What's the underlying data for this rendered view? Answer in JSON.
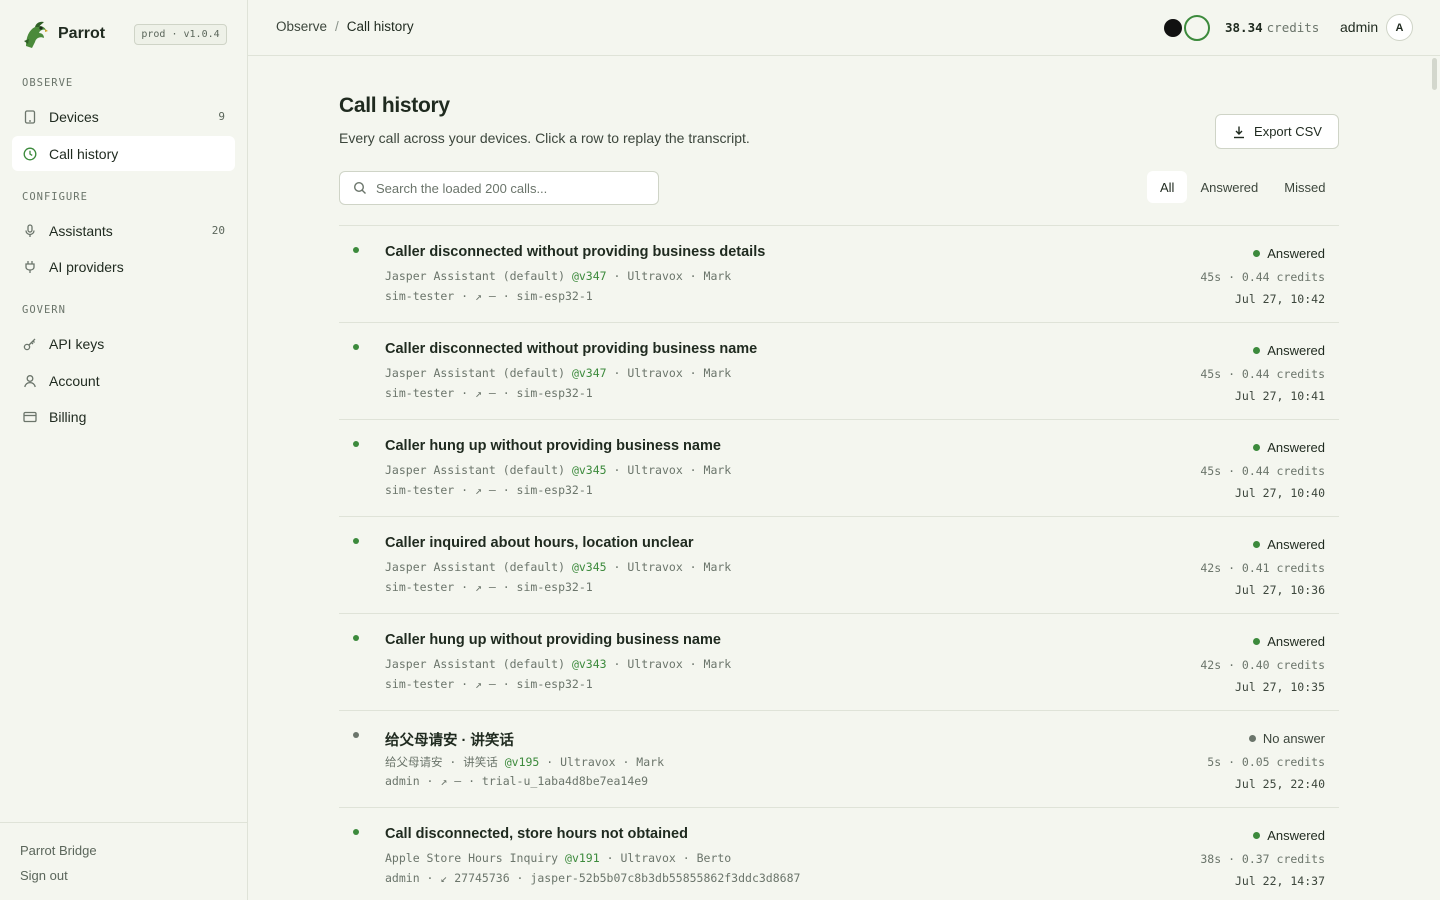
{
  "app": {
    "name": "Parrot",
    "env_badge": "prod · v1.0.4"
  },
  "sidebar": {
    "sections": [
      {
        "label": "OBSERVE",
        "items": [
          {
            "label": "Devices",
            "icon": "tablet-icon",
            "count": "9",
            "active": false
          },
          {
            "label": "Call history",
            "icon": "clock-icon",
            "count": "",
            "active": true
          }
        ]
      },
      {
        "label": "CONFIGURE",
        "items": [
          {
            "label": "Assistants",
            "icon": "microphone-icon",
            "count": "20",
            "active": false
          },
          {
            "label": "AI providers",
            "icon": "plug-icon",
            "count": "",
            "active": false
          }
        ]
      },
      {
        "label": "GOVERN",
        "items": [
          {
            "label": "API keys",
            "icon": "key-icon",
            "count": "",
            "active": false
          },
          {
            "label": "Account",
            "icon": "user-icon",
            "count": "",
            "active": false
          },
          {
            "label": "Billing",
            "icon": "credit-card-icon",
            "count": "",
            "active": false
          }
        ]
      }
    ],
    "footer": {
      "bridge_label": "Parrot Bridge",
      "signout_label": "Sign out"
    }
  },
  "topbar": {
    "breadcrumb": {
      "parent": "Observe",
      "separator": "/",
      "current": "Call history"
    },
    "credits_value": "38.34",
    "credits_unit": "credits",
    "user_name": "admin",
    "avatar_initial": "A"
  },
  "main": {
    "title": "Call history",
    "subtitle": "Every call across your devices. Click a row to replay the transcript.",
    "export_label": "Export CSV",
    "search_placeholder": "Search the loaded 200 calls...",
    "filters": [
      {
        "label": "All",
        "active": true
      },
      {
        "label": "Answered",
        "active": false
      },
      {
        "label": "Missed",
        "active": false
      }
    ],
    "calls": [
      {
        "title": "Caller disconnected without providing business details",
        "assistant": "Jasper Assistant (default)",
        "version": "@v347",
        "provider": "Ultravox",
        "voice": "Mark",
        "line2": "sim-tester · ↗ — · sim-esp32-1",
        "status": "Answered",
        "missed": false,
        "cost": "45s · 0.44 credits",
        "time": "Jul 27, 10:42"
      },
      {
        "title": "Caller disconnected without providing business name",
        "assistant": "Jasper Assistant (default)",
        "version": "@v347",
        "provider": "Ultravox",
        "voice": "Mark",
        "line2": "sim-tester · ↗ — · sim-esp32-1",
        "status": "Answered",
        "missed": false,
        "cost": "45s · 0.44 credits",
        "time": "Jul 27, 10:41"
      },
      {
        "title": "Caller hung up without providing business name",
        "assistant": "Jasper Assistant (default)",
        "version": "@v345",
        "provider": "Ultravox",
        "voice": "Mark",
        "line2": "sim-tester · ↗ — · sim-esp32-1",
        "status": "Answered",
        "missed": false,
        "cost": "45s · 0.44 credits",
        "time": "Jul 27, 10:40"
      },
      {
        "title": "Caller inquired about hours, location unclear",
        "assistant": "Jasper Assistant (default)",
        "version": "@v345",
        "provider": "Ultravox",
        "voice": "Mark",
        "line2": "sim-tester · ↗ — · sim-esp32-1",
        "status": "Answered",
        "missed": false,
        "cost": "42s · 0.41 credits",
        "time": "Jul 27, 10:36"
      },
      {
        "title": "Caller hung up without providing business name",
        "assistant": "Jasper Assistant (default)",
        "version": "@v343",
        "provider": "Ultravox",
        "voice": "Mark",
        "line2": "sim-tester · ↗ — · sim-esp32-1",
        "status": "Answered",
        "missed": false,
        "cost": "42s · 0.40 credits",
        "time": "Jul 27, 10:35"
      },
      {
        "title": "给父母请安 · 讲笑话",
        "assistant": "给父母请安 · 讲笑话",
        "version": "@v195",
        "provider": "Ultravox",
        "voice": "Mark",
        "line2": "admin · ↗ — · trial-u_1aba4d8be7ea14e9",
        "status": "No answer",
        "missed": true,
        "cost": "5s · 0.05 credits",
        "time": "Jul 25, 22:40"
      },
      {
        "title": "Call disconnected, store hours not obtained",
        "assistant": "Apple Store Hours Inquiry",
        "version": "@v191",
        "provider": "Ultravox",
        "voice": "Berto",
        "line2": "admin · ↙ 27745736 · jasper-52b5b07c8b3db55855862f3ddc3d8687",
        "status": "Answered",
        "missed": false,
        "cost": "38s · 0.37 credits",
        "time": "Jul 22, 14:37"
      }
    ]
  },
  "colors": {
    "accent": "#3c8a3c",
    "background": "#f4f6ef",
    "muted": "#6b756b"
  }
}
